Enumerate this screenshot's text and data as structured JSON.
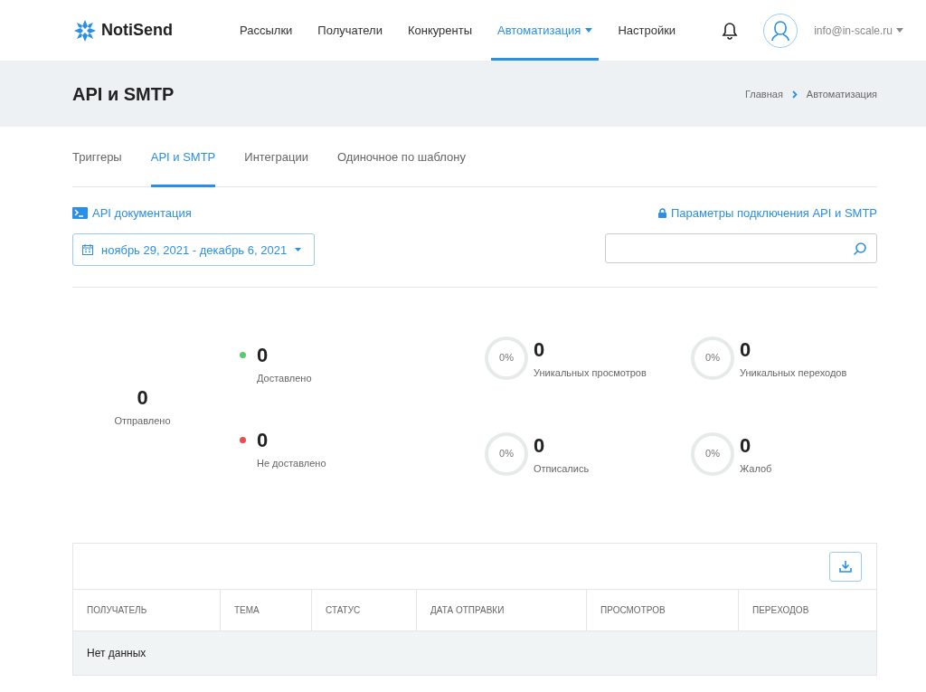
{
  "header": {
    "logo": "NotiSend",
    "nav": [
      {
        "label": "Рассылки",
        "selected": false,
        "dropdown": false
      },
      {
        "label": "Получатели",
        "selected": false,
        "dropdown": false
      },
      {
        "label": "Конкуренты",
        "selected": false,
        "dropdown": false
      },
      {
        "label": "Автоматизация",
        "selected": true,
        "dropdown": true
      },
      {
        "label": "Настройки",
        "selected": false,
        "dropdown": false
      }
    ],
    "user": "info@in-scale.ru"
  },
  "page": {
    "title": "API и SMTP",
    "breadcrumbs": [
      "Главная",
      "Автоматизация"
    ]
  },
  "tabs": [
    {
      "label": "Триггеры",
      "selected": false
    },
    {
      "label": "API и SMTP",
      "selected": true
    },
    {
      "label": "Интеграции",
      "selected": false
    },
    {
      "label": "Одиночное по шаблону",
      "selected": false
    }
  ],
  "api_docs_link": "API документация",
  "connection_link": "Параметры подключения API и SMTP",
  "date_range": "ноябрь 29, 2021 - декабрь 6, 2021",
  "sent": {
    "value": "0",
    "label": "Отправлено"
  },
  "delivery": [
    {
      "value": "0",
      "label": "Доставлено",
      "color": "#5cc970"
    },
    {
      "value": "0",
      "label": "Не доставлено",
      "color": "#ee4b4b"
    }
  ],
  "rates": [
    {
      "percent": "0%",
      "level": 0,
      "value": "0",
      "label": "Уникальных просмотров"
    },
    {
      "percent": "0%",
      "level": 0,
      "value": "0",
      "label": "Уникальных переходов"
    },
    {
      "percent": "0%",
      "level": 0,
      "value": "0",
      "label": "Отписались"
    },
    {
      "percent": "0%",
      "level": 0,
      "value": "0",
      "label": "Жалоб"
    }
  ],
  "table": {
    "columns": [
      "ПОЛУЧАТЕЛЬ",
      "ТЕМА",
      "СТАТУС",
      "ДАТА ОТПРАВКИ",
      "ПРОСМОТРОВ",
      "ПЕРЕХОДОВ"
    ],
    "empty_text": "Нет данных"
  }
}
